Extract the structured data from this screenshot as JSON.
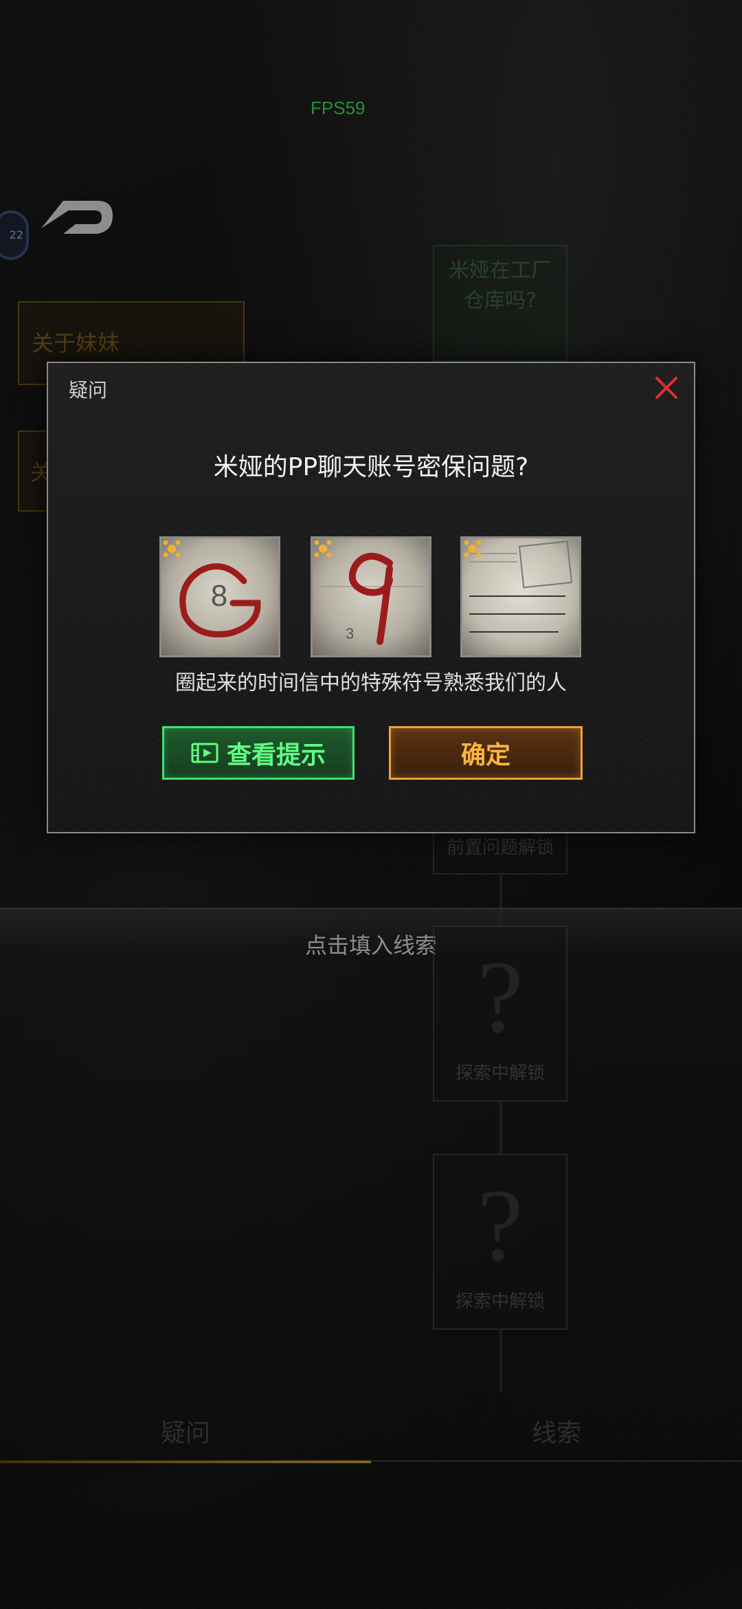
{
  "status": {
    "fps": "FPS59"
  },
  "player": {
    "level": "22"
  },
  "board": {
    "cards": [
      {
        "text": "关于妹妹"
      },
      {
        "text": "关"
      },
      {
        "text": "米娅在工厂仓库吗?"
      },
      {
        "text": "前置问题解锁"
      },
      {
        "symbol": "?",
        "text": "探索中解锁"
      },
      {
        "symbol": "?",
        "text": "探索中解锁"
      }
    ]
  },
  "bottom_panel": {
    "hint": "点击填入线索",
    "tabs": [
      "疑问",
      "线索"
    ]
  },
  "modal": {
    "title": "疑问",
    "question": "米娅的PP聊天账号密保问题?",
    "clues": [
      {
        "icon": "circled-8-clue"
      },
      {
        "icon": "circled-9-clue"
      },
      {
        "icon": "letter-clue"
      }
    ],
    "hint_text": "圈起来的时间信中的特殊符号熟悉我们的人",
    "hint_button": "查看提示",
    "confirm_button": "确定"
  },
  "colors": {
    "hint_green": "#3fe070",
    "confirm_orange": "#f0a03a",
    "close_red": "#e03030",
    "fps_green": "#3ddc5a"
  }
}
